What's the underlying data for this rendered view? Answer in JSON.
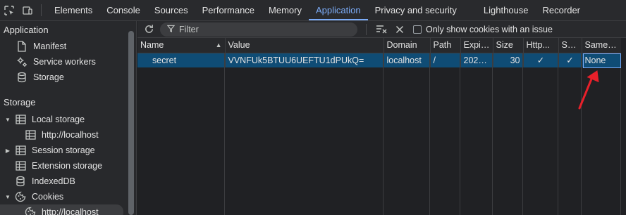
{
  "topbar": {
    "tabs": [
      {
        "label": "Elements",
        "active": false
      },
      {
        "label": "Console",
        "active": false
      },
      {
        "label": "Sources",
        "active": false
      },
      {
        "label": "Performance",
        "active": false
      },
      {
        "label": "Memory",
        "active": false
      },
      {
        "label": "Application",
        "active": true
      },
      {
        "label": "Privacy and security",
        "active": false
      },
      {
        "label": "Lighthouse",
        "active": false
      },
      {
        "label": "Recorder",
        "active": false
      }
    ],
    "icons": [
      "inspect-icon",
      "device-toolbar-icon"
    ]
  },
  "sidebar": {
    "application_title": "Application",
    "application_items": [
      {
        "label": "Manifest",
        "icon": "file-icon"
      },
      {
        "label": "Service workers",
        "icon": "gear-icon"
      },
      {
        "label": "Storage",
        "icon": "database-icon"
      }
    ],
    "storage_title": "Storage",
    "storage_items": [
      {
        "label": "Local storage",
        "icon": "table-icon",
        "expanded": true
      },
      {
        "label": "http://localhost",
        "icon": "table-icon",
        "child": true
      },
      {
        "label": "Session storage",
        "icon": "table-icon",
        "expanded": false
      },
      {
        "label": "Extension storage",
        "icon": "table-icon"
      },
      {
        "label": "IndexedDB",
        "icon": "database-icon"
      },
      {
        "label": "Cookies",
        "icon": "cookie-icon",
        "expanded": true
      },
      {
        "label": "http://localhost",
        "icon": "cookie-icon",
        "child": true,
        "selected": true
      }
    ]
  },
  "filterbar": {
    "filter_placeholder": "Filter",
    "only_issues_label": "Only show cookies with an issue"
  },
  "table": {
    "columns": [
      "Name",
      "Value",
      "Domain",
      "Path",
      "Expir...",
      "Size",
      "Http...",
      "Se...",
      "SameSite"
    ],
    "sort_indicator": "▲",
    "rows": [
      {
        "name": "secret",
        "value": "VVNFUk5BTUU6UEFTU1dPUkQ=",
        "domain": "localhost",
        "path": "/",
        "expires": "2025...",
        "size": "30",
        "httponly": "✓",
        "secure": "✓",
        "samesite": "None"
      }
    ]
  },
  "colors": {
    "accent": "#7cacf8",
    "selected_row": "#0f4c75",
    "annotation_arrow": "#e8202a"
  }
}
